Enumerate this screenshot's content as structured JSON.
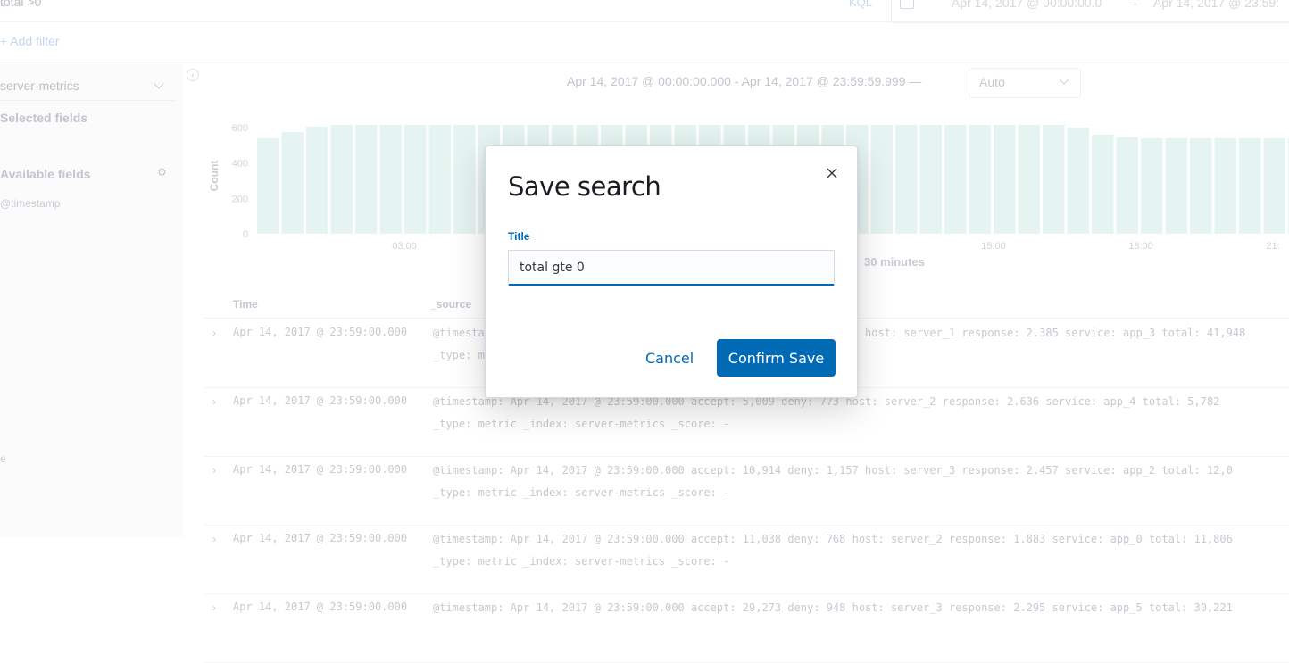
{
  "app": {
    "query": "total >0",
    "query_language": "KQL",
    "date_start": "Apr 14, 2017 @ 00:00:00.0",
    "date_end": "Apr 14, 2017 @ 23:59:",
    "add_filter": "+ Add filter"
  },
  "sidebar": {
    "index_pattern": "server-metrics",
    "selected_fields": "Selected fields",
    "available_fields": "Available fields",
    "field_timestamp": "@timestamp",
    "field_e": "e"
  },
  "chart": {
    "range_label": "Apr 14, 2017 @ 00:00:00.000 - Apr 14, 2017 @ 23:59:59.999 —",
    "interval": "Auto",
    "interval_note": "30 minutes"
  },
  "chart_data": {
    "type": "bar",
    "ylabel": "Count",
    "ylim": [
      0,
      650
    ],
    "y_ticks": [
      "0",
      "200",
      "400",
      "600"
    ],
    "x_ticks": [
      "03:00",
      "15:00",
      "18:00",
      "21:"
    ],
    "values": [
      540,
      575,
      605,
      615,
      615,
      615,
      615,
      615,
      615,
      615,
      615,
      615,
      615,
      615,
      615,
      615,
      615,
      615,
      615,
      615,
      615,
      615,
      615,
      615,
      615,
      615,
      615,
      615,
      615,
      615,
      615,
      615,
      615,
      600,
      560,
      545,
      540,
      540,
      540,
      540,
      540,
      540,
      540,
      540,
      540,
      540,
      540
    ],
    "color": "#e6f4f1"
  },
  "table": {
    "col_time": "Time",
    "col_source": "_source",
    "rows": [
      {
        "time": "Apr 14, 2017 @ 23:59:00.000",
        "line1": "@timestamp: Apr 14, 2017 @ 23:59:00.000  accept: 11,838  deny: 1,002  host: server_1  response: 2.385  service: app_3  total: 41,948",
        "line2": "_type: metric  _index: server-metrics  _score:  -"
      },
      {
        "time": "Apr 14, 2017 @ 23:59:00.000",
        "line1": "@timestamp: Apr 14, 2017 @ 23:59:00.000  accept: 5,009  deny: 773  host: server_2  response: 2.636  service: app_4  total: 5,782",
        "line2": "_type: metric  _index: server-metrics  _score:  -"
      },
      {
        "time": "Apr 14, 2017 @ 23:59:00.000",
        "line1": "@timestamp: Apr 14, 2017 @ 23:59:00.000  accept: 10,914  deny: 1,157  host: server_3  response: 2.457  service: app_2  total: 12,0",
        "line2": "_type: metric  _index: server-metrics  _score:  -"
      },
      {
        "time": "Apr 14, 2017 @ 23:59:00.000",
        "line1": "@timestamp: Apr 14, 2017 @ 23:59:00.000  accept: 11,038  deny: 768  host: server_2  response: 1.883  service: app_0  total: 11,806",
        "line2": "_type: metric  _index: server-metrics  _score:  -"
      },
      {
        "time": "Apr 14, 2017 @ 23:59:00.000",
        "line1": "@timestamp: Apr 14, 2017 @ 23:59:00.000  accept: 29,273  deny: 948  host: server_3  response: 2.295  service: app_5  total: 30,221",
        "line2": ""
      }
    ]
  },
  "modal": {
    "title": "Save search",
    "field_label": "Title",
    "input_value": "total gte 0",
    "cancel_label": "Cancel",
    "confirm_label": "Confirm Save",
    "close_icon": "close-icon"
  }
}
